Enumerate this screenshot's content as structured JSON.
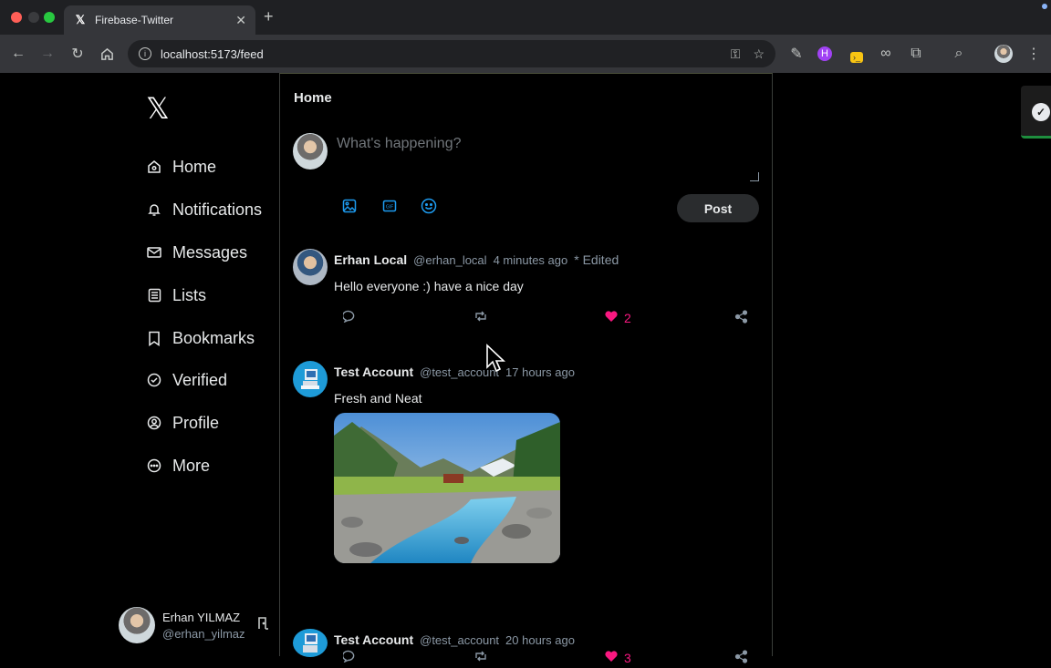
{
  "browser": {
    "tab_title": "Firebase-Twitter",
    "tab_favicon": "𝕏",
    "url": "localhost:5173/feed"
  },
  "sidebar": {
    "logo": "𝕏",
    "items": [
      {
        "label": "Home",
        "icon": "home-icon"
      },
      {
        "label": "Notifications",
        "icon": "bell-icon"
      },
      {
        "label": "Messages",
        "icon": "mail-icon"
      },
      {
        "label": "Lists",
        "icon": "list-icon"
      },
      {
        "label": "Bookmarks",
        "icon": "bookmark-icon"
      },
      {
        "label": "Verified",
        "icon": "verified-icon"
      },
      {
        "label": "Profile",
        "icon": "profile-icon"
      },
      {
        "label": "More",
        "icon": "more-icon"
      }
    ],
    "me": {
      "name": "Erhan YILMAZ",
      "handle": "@erhan_yilmaz"
    }
  },
  "feed": {
    "title": "Home",
    "composer": {
      "placeholder": "What's happening?",
      "post_label": "Post"
    },
    "tweets": [
      {
        "name": "Erhan Local",
        "handle": "@erhan_local",
        "time": "4 minutes ago",
        "edited": "* Edited",
        "text": "Hello everyone :) have a nice day",
        "likes": "2"
      },
      {
        "name": "Test Account",
        "handle": "@test_account",
        "time": "17 hours ago",
        "text": "Fresh and Neat",
        "likes": "3"
      },
      {
        "name": "Test Account",
        "handle": "@test_account",
        "time": "20 hours ago"
      }
    ]
  },
  "colors": {
    "accent": "#1d9bf0",
    "like": "#f91880",
    "background": "#000000"
  }
}
